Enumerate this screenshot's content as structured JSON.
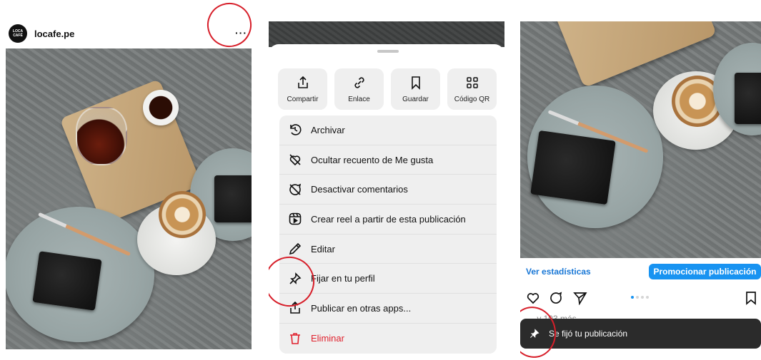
{
  "post": {
    "avatar_text": "LOCA CAFÉ",
    "username": "locafe.pe",
    "more_glyph": "···"
  },
  "sheet": {
    "quick_actions": [
      {
        "label": "Compartir",
        "icon": "share-icon"
      },
      {
        "label": "Enlace",
        "icon": "link-icon"
      },
      {
        "label": "Guardar",
        "icon": "bookmark-icon"
      },
      {
        "label": "Código QR",
        "icon": "qr-code-icon"
      }
    ],
    "menu": [
      {
        "label": "Archivar",
        "icon": "archive-icon"
      },
      {
        "label": "Ocultar recuento de Me gusta",
        "icon": "hide-likes-icon"
      },
      {
        "label": "Desactivar comentarios",
        "icon": "comments-off-icon"
      },
      {
        "label": "Crear reel a partir de esta publicación",
        "icon": "reel-icon"
      },
      {
        "label": "Editar",
        "icon": "pencil-icon"
      },
      {
        "label": "Fijar en tu perfil",
        "icon": "pin-icon"
      },
      {
        "label": "Publicar en otras apps...",
        "icon": "share-out-icon"
      },
      {
        "label": "Eliminar",
        "icon": "trash-icon",
        "color": "#e0212d"
      }
    ]
  },
  "result": {
    "stats_link": "Ver estadísticas",
    "promote_button": "Promocionar publicación",
    "carousel_dots": 4,
    "carousel_active": 1,
    "liked_by_text": "… y 103 más",
    "toast_text": "Se fijó tu publicación",
    "colors": {
      "accent": "#1893f1",
      "link": "#1877d6",
      "danger": "#e0212d",
      "annotation": "#d71f2a"
    }
  }
}
